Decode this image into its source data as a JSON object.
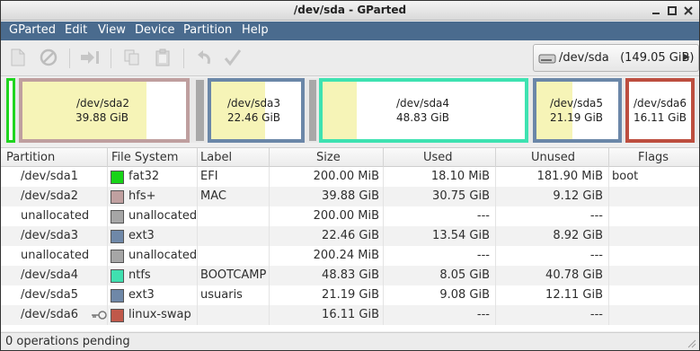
{
  "window": {
    "title": "/dev/sda - GParted"
  },
  "menu": [
    "GParted",
    "Edit",
    "View",
    "Device",
    "Partition",
    "Help"
  ],
  "toolbar": {
    "buttons": [
      "new-partition",
      "delete-partition",
      "resize-move",
      "copy",
      "paste",
      "undo",
      "apply"
    ]
  },
  "device": {
    "label": "/dev/sda   (149.05 GiB)"
  },
  "map": {
    "partitions": [
      {
        "name": "/dev/sda2",
        "size": "39.88 GiB",
        "color": "#bf9f9f"
      },
      {
        "name": "/dev/sda3",
        "size": "22.46 GiB",
        "color": "#6b87a8"
      },
      {
        "name": "/dev/sda4",
        "size": "48.83 GiB",
        "color": "#3ee2b1"
      },
      {
        "name": "/dev/sda5",
        "size": "21.19 GiB",
        "color": "#6b87a8"
      },
      {
        "name": "/dev/sda6",
        "size": "16.11 GiB",
        "color": "#bd4e3f"
      }
    ],
    "sda1_color": "#1fd51f"
  },
  "table": {
    "headers": [
      "Partition",
      "File System",
      "Label",
      "Size",
      "Used",
      "Unused",
      "Flags"
    ],
    "rows": [
      {
        "partition": "/dev/sda1",
        "fs": "fat32",
        "fs_color": "#18d418",
        "label": "EFI",
        "size": "200.00 MiB",
        "used": "18.10 MiB",
        "unused": "181.90 MiB",
        "flags": "boot"
      },
      {
        "partition": "/dev/sda2",
        "fs": "hfs+",
        "fs_color": "#c0a0a0",
        "label": "MAC",
        "size": "39.88 GiB",
        "used": "30.75 GiB",
        "unused": "9.12 GiB",
        "flags": ""
      },
      {
        "partition": "unallocated",
        "fs": "unallocated",
        "fs_color": "#a6a6a6",
        "label": "",
        "size": "200.00 MiB",
        "used": "---",
        "unused": "---",
        "flags": ""
      },
      {
        "partition": "/dev/sda3",
        "fs": "ext3",
        "fs_color": "#6f88a8",
        "label": "",
        "size": "22.46 GiB",
        "used": "13.54 GiB",
        "unused": "8.92 GiB",
        "flags": ""
      },
      {
        "partition": "unallocated",
        "fs": "unallocated",
        "fs_color": "#a6a6a6",
        "label": "",
        "size": "200.24 MiB",
        "used": "---",
        "unused": "---",
        "flags": ""
      },
      {
        "partition": "/dev/sda4",
        "fs": "ntfs",
        "fs_color": "#40e0b0",
        "label": "BOOTCAMP",
        "size": "48.83 GiB",
        "used": "8.05 GiB",
        "unused": "40.78 GiB",
        "flags": ""
      },
      {
        "partition": "/dev/sda5",
        "fs": "ext3",
        "fs_color": "#6f88a8",
        "label": "usuaris",
        "size": "21.19 GiB",
        "used": "9.08 GiB",
        "unused": "12.11 GiB",
        "flags": ""
      },
      {
        "partition": "/dev/sda6",
        "fs": "linux-swap",
        "fs_color": "#c0584a",
        "label": "",
        "size": "16.11 GiB",
        "used": "---",
        "unused": "---",
        "flags": "",
        "key_icon": true
      }
    ]
  },
  "status": {
    "text": "0 operations pending"
  }
}
